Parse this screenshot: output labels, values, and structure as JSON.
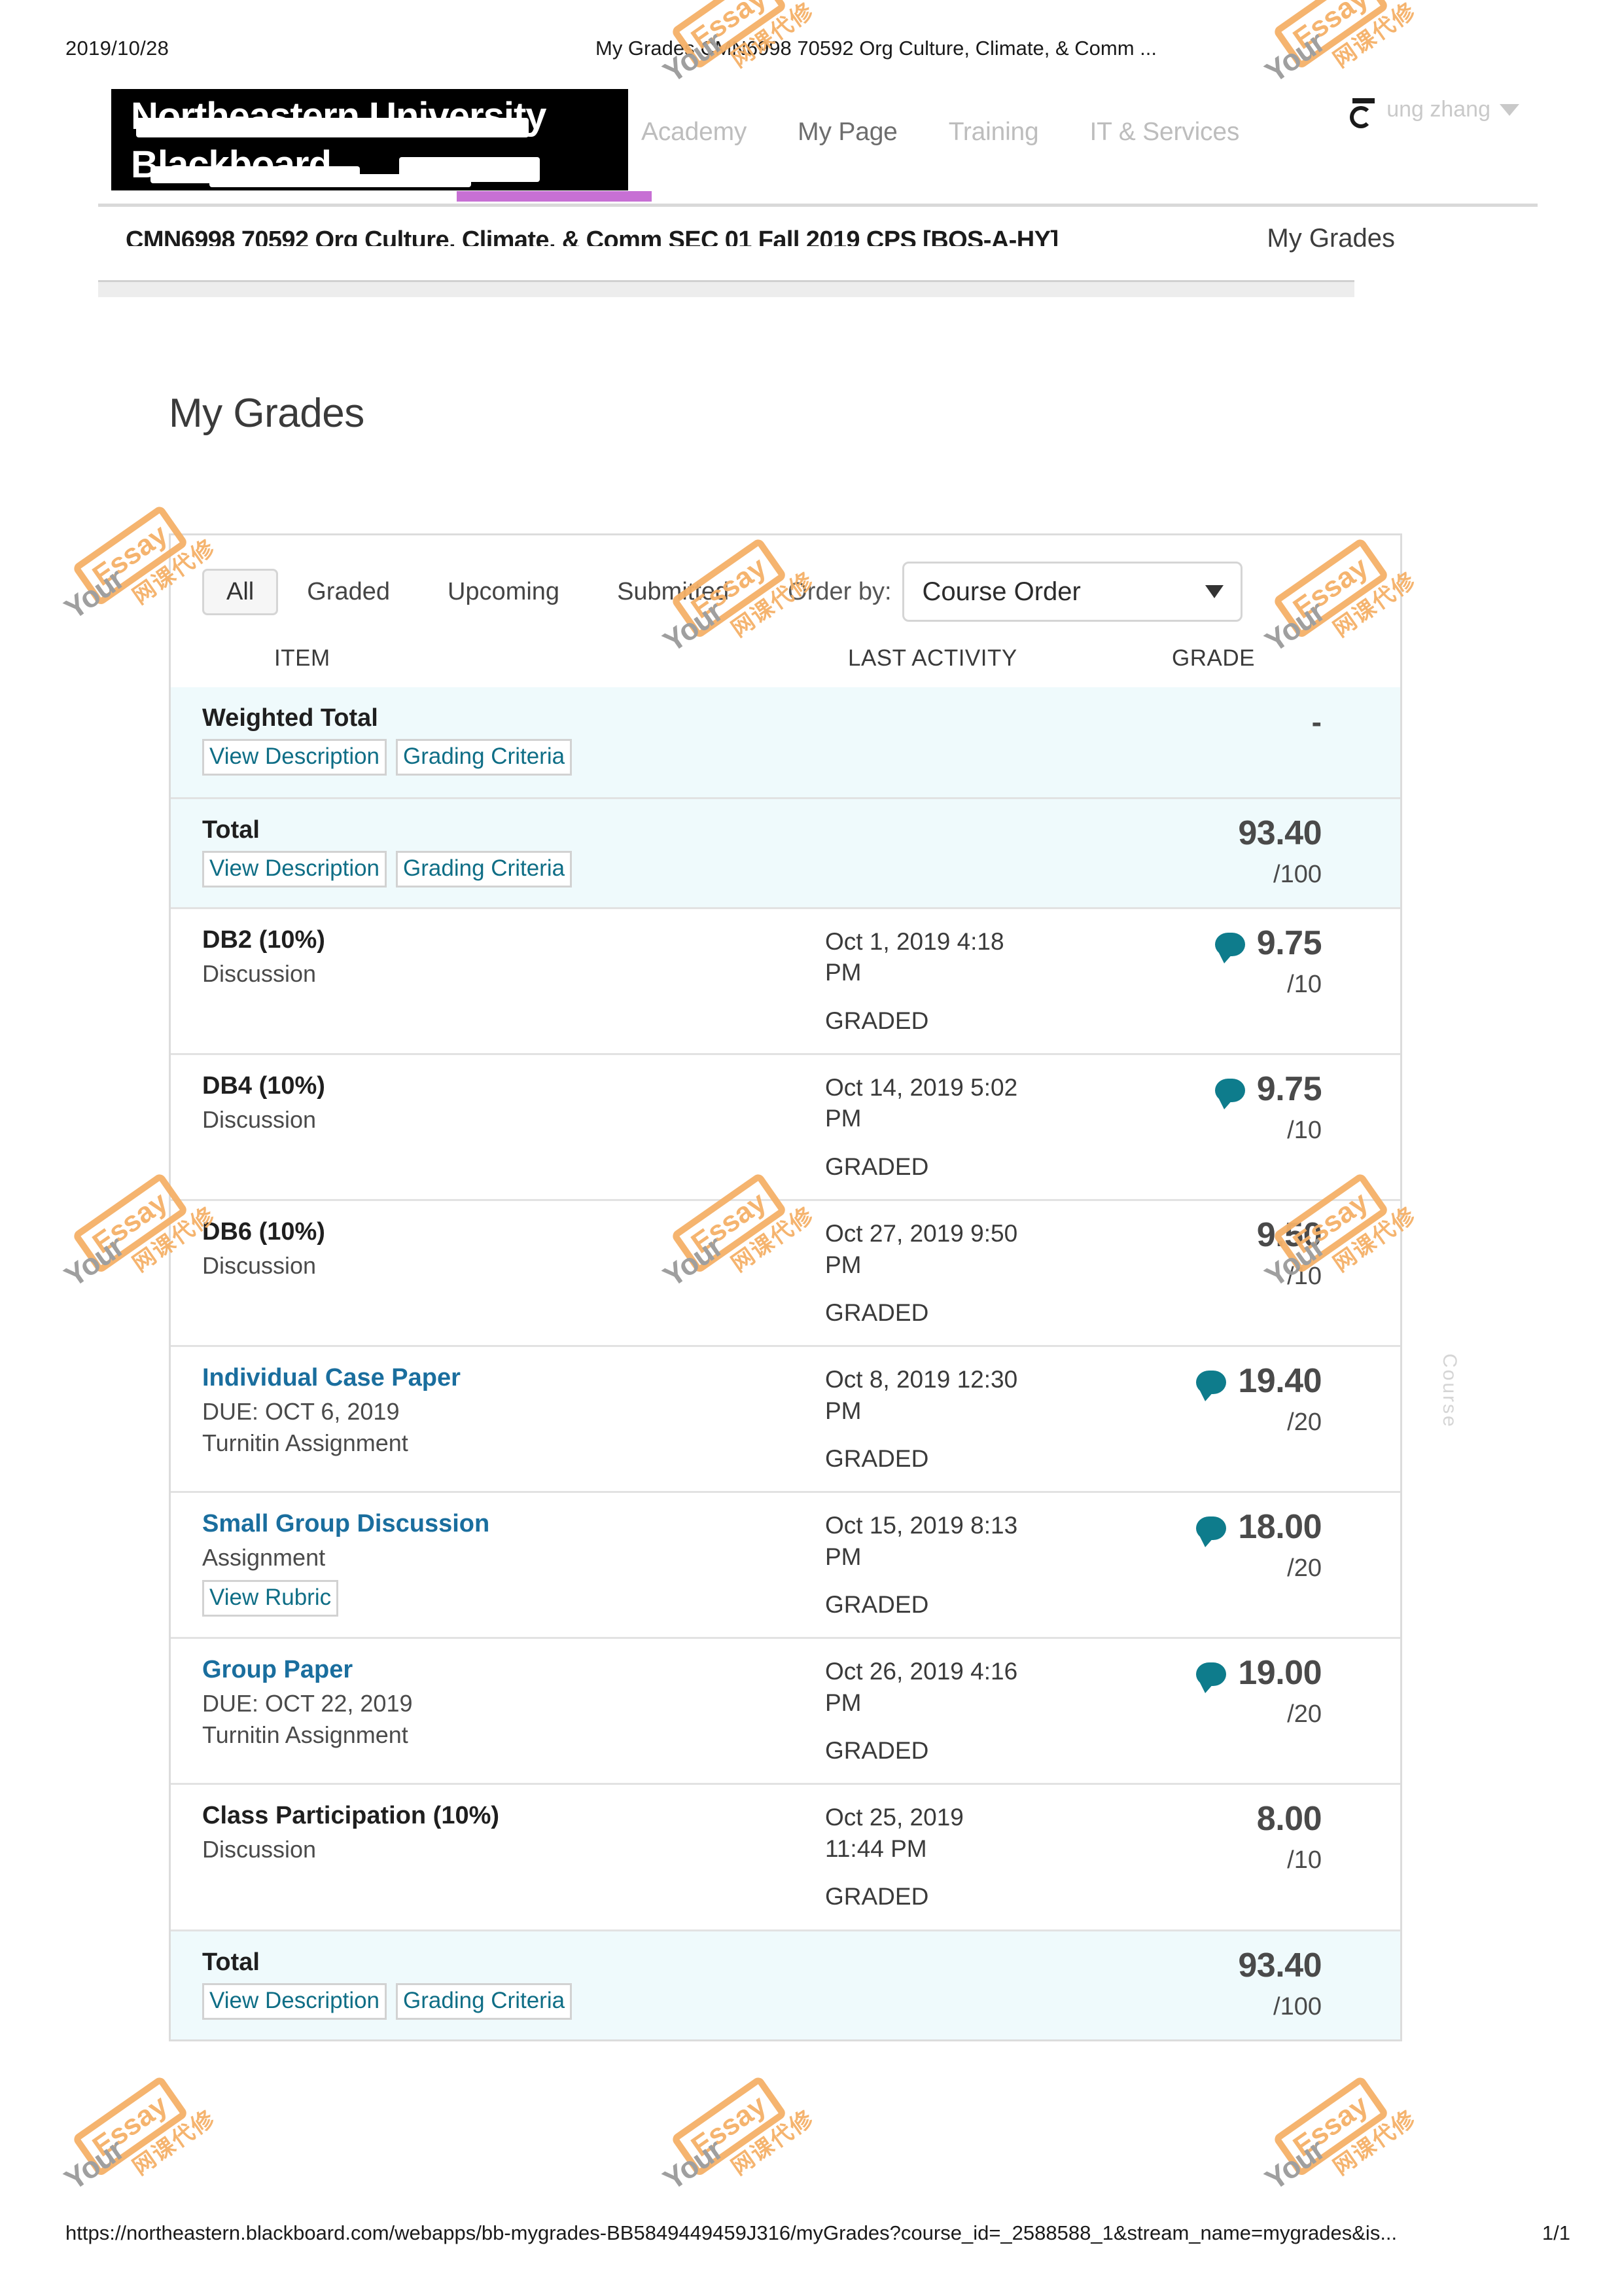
{
  "print": {
    "date": "2019/10/28",
    "title": "My Grades  CMN6998 70592 Org Culture, Climate, & Comm ...",
    "url": "https://northeastern.blackboard.com/webapps/bb-mygrades-BB5849449459J316/myGrades?course_id=_2588588_1&stream_name=mygrades&is...",
    "page_number": "1/1"
  },
  "masthead": {
    "logo_line1": "Northeastern University",
    "logo_line2": "Blackboard",
    "nav": [
      {
        "label": "Academy"
      },
      {
        "label": "My Page"
      },
      {
        "label": "Training"
      },
      {
        "label": "IT & Services"
      }
    ],
    "user_label": "ung zhang"
  },
  "coursebar": {
    "course_title": "CMN6998 70592 Org Culture, Climate, & Comm SEC 01 Fall 2019 CPS [BOS-A-HY]",
    "section_label": "My Grades"
  },
  "page_title": "My Grades",
  "side_tab_label": "Course",
  "filters": {
    "tabs": [
      {
        "label": "All",
        "active": true
      },
      {
        "label": "Graded",
        "active": false
      },
      {
        "label": "Upcoming",
        "active": false
      },
      {
        "label": "Submitted",
        "active": false
      }
    ],
    "order_by_label": "Order by:",
    "order_by_value": "Course Order"
  },
  "columns": {
    "item": "ITEM",
    "last_activity": "LAST ACTIVITY",
    "grade": "GRADE"
  },
  "colors": {
    "accent_purple": "#c770d4",
    "link_blue": "#1a6e9e",
    "bubble_teal": "#0e7c8c",
    "highlight_red": "#f57272",
    "total_row_bg": "#effafc"
  },
  "labels": {
    "view_description": "View Description",
    "grading_criteria": "Grading Criteria",
    "view_rubric": "View Rubric",
    "status_graded": "GRADED",
    "bubble_icon": "comment-bubble-icon"
  },
  "rows": [
    {
      "name": "Weighted Total",
      "type": "",
      "due": "",
      "link": false,
      "buttons": [
        "View Description",
        "Grading Criteria"
      ],
      "activity_date": "",
      "activity_time": "",
      "status": "",
      "grade": "-",
      "out_of": "",
      "has_comment": false,
      "total": true,
      "highlight": false
    },
    {
      "name": "Total",
      "type": "",
      "due": "",
      "link": false,
      "buttons": [
        "View Description",
        "Grading Criteria"
      ],
      "activity_date": "",
      "activity_time": "",
      "status": "",
      "grade": "93.40",
      "out_of": "/100",
      "has_comment": false,
      "total": true,
      "highlight": true
    },
    {
      "name": "DB2 (10%)",
      "type": "Discussion",
      "due": "",
      "link": false,
      "buttons": [],
      "activity_date": "Oct 1, 2019 4:18",
      "activity_time": "PM",
      "status": "GRADED",
      "grade": "9.75",
      "out_of": "/10",
      "has_comment": true,
      "total": false,
      "highlight": false
    },
    {
      "name": "DB4 (10%)",
      "type": "Discussion",
      "due": "",
      "link": false,
      "buttons": [],
      "activity_date": "Oct 14, 2019 5:02",
      "activity_time": "PM",
      "status": "GRADED",
      "grade": "9.75",
      "out_of": "/10",
      "has_comment": true,
      "total": false,
      "highlight": false
    },
    {
      "name": "DB6 (10%)",
      "type": "Discussion",
      "due": "",
      "link": false,
      "buttons": [],
      "activity_date": "Oct 27, 2019 9:50",
      "activity_time": "PM",
      "status": "GRADED",
      "grade": "9.50",
      "out_of": "/10",
      "has_comment": false,
      "total": false,
      "highlight": false
    },
    {
      "name": "Individual Case Paper",
      "type": "Turnitin Assignment",
      "due": "DUE: OCT 6, 2019",
      "link": true,
      "buttons": [],
      "activity_date": "Oct 8, 2019 12:30",
      "activity_time": "PM",
      "status": "GRADED",
      "grade": "19.40",
      "out_of": "/20",
      "has_comment": true,
      "total": false,
      "highlight": false
    },
    {
      "name": "Small Group Discussion",
      "type": "Assignment",
      "due": "",
      "link": true,
      "buttons": [
        "View Rubric"
      ],
      "activity_date": "Oct 15, 2019 8:13",
      "activity_time": "PM",
      "status": "GRADED",
      "grade": "18.00",
      "out_of": "/20",
      "has_comment": true,
      "total": false,
      "highlight": false
    },
    {
      "name": "Group Paper",
      "type": "Turnitin Assignment",
      "due": "DUE: OCT 22, 2019",
      "link": true,
      "buttons": [],
      "activity_date": "Oct 26, 2019 4:16",
      "activity_time": "PM",
      "status": "GRADED",
      "grade": "19.00",
      "out_of": "/20",
      "has_comment": true,
      "total": false,
      "highlight": false
    },
    {
      "name": "Class Participation (10%)",
      "type": "Discussion",
      "due": "",
      "link": false,
      "buttons": [],
      "activity_date": "Oct 25, 2019",
      "activity_time": "11:44 PM",
      "status": "GRADED",
      "grade": "8.00",
      "out_of": "/10",
      "has_comment": false,
      "total": false,
      "highlight": false
    },
    {
      "name": "Total",
      "type": "",
      "due": "",
      "link": false,
      "buttons": [
        "View Description",
        "Grading Criteria"
      ],
      "activity_date": "",
      "activity_time": "",
      "status": "",
      "grade": "93.40",
      "out_of": "/100",
      "has_comment": false,
      "total": true,
      "highlight": false
    }
  ],
  "watermark": {
    "english": "Your",
    "boxed": "Essay",
    "chinese": "网课代修"
  }
}
